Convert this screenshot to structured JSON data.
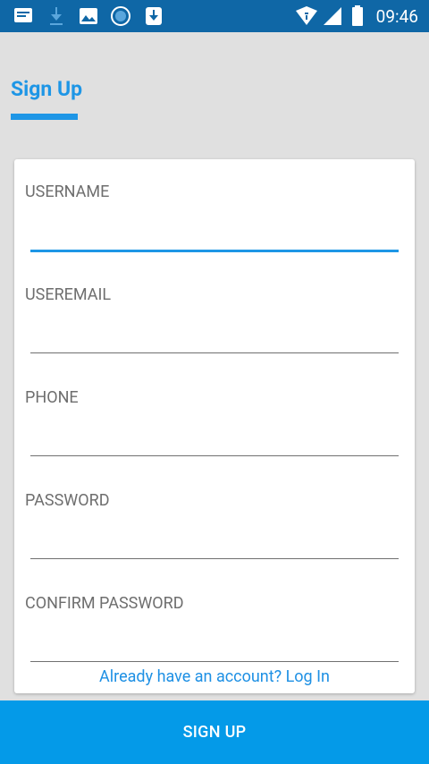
{
  "status_bar": {
    "time": "09:46",
    "icons": [
      "message-icon",
      "download-icon",
      "image-icon",
      "sync-icon",
      "download-box-icon",
      "wifi-icon",
      "signal-icon",
      "battery-icon"
    ]
  },
  "header": {
    "title": "Sign Up"
  },
  "form": {
    "fields": [
      {
        "label": "USERNAME",
        "value": ""
      },
      {
        "label": "USEREMAIL",
        "value": ""
      },
      {
        "label": "PHONE",
        "value": ""
      },
      {
        "label": "PASSWORD",
        "value": ""
      },
      {
        "label": "CONFIRM PASSWORD",
        "value": ""
      }
    ],
    "login_link": "Already have an account? Log In"
  },
  "actions": {
    "signup_label": "SIGN UP"
  },
  "colors": {
    "status_bar": "#0f67a6",
    "accent": "#1e96e6",
    "button": "#049ae8",
    "background": "#e0e0e0"
  }
}
